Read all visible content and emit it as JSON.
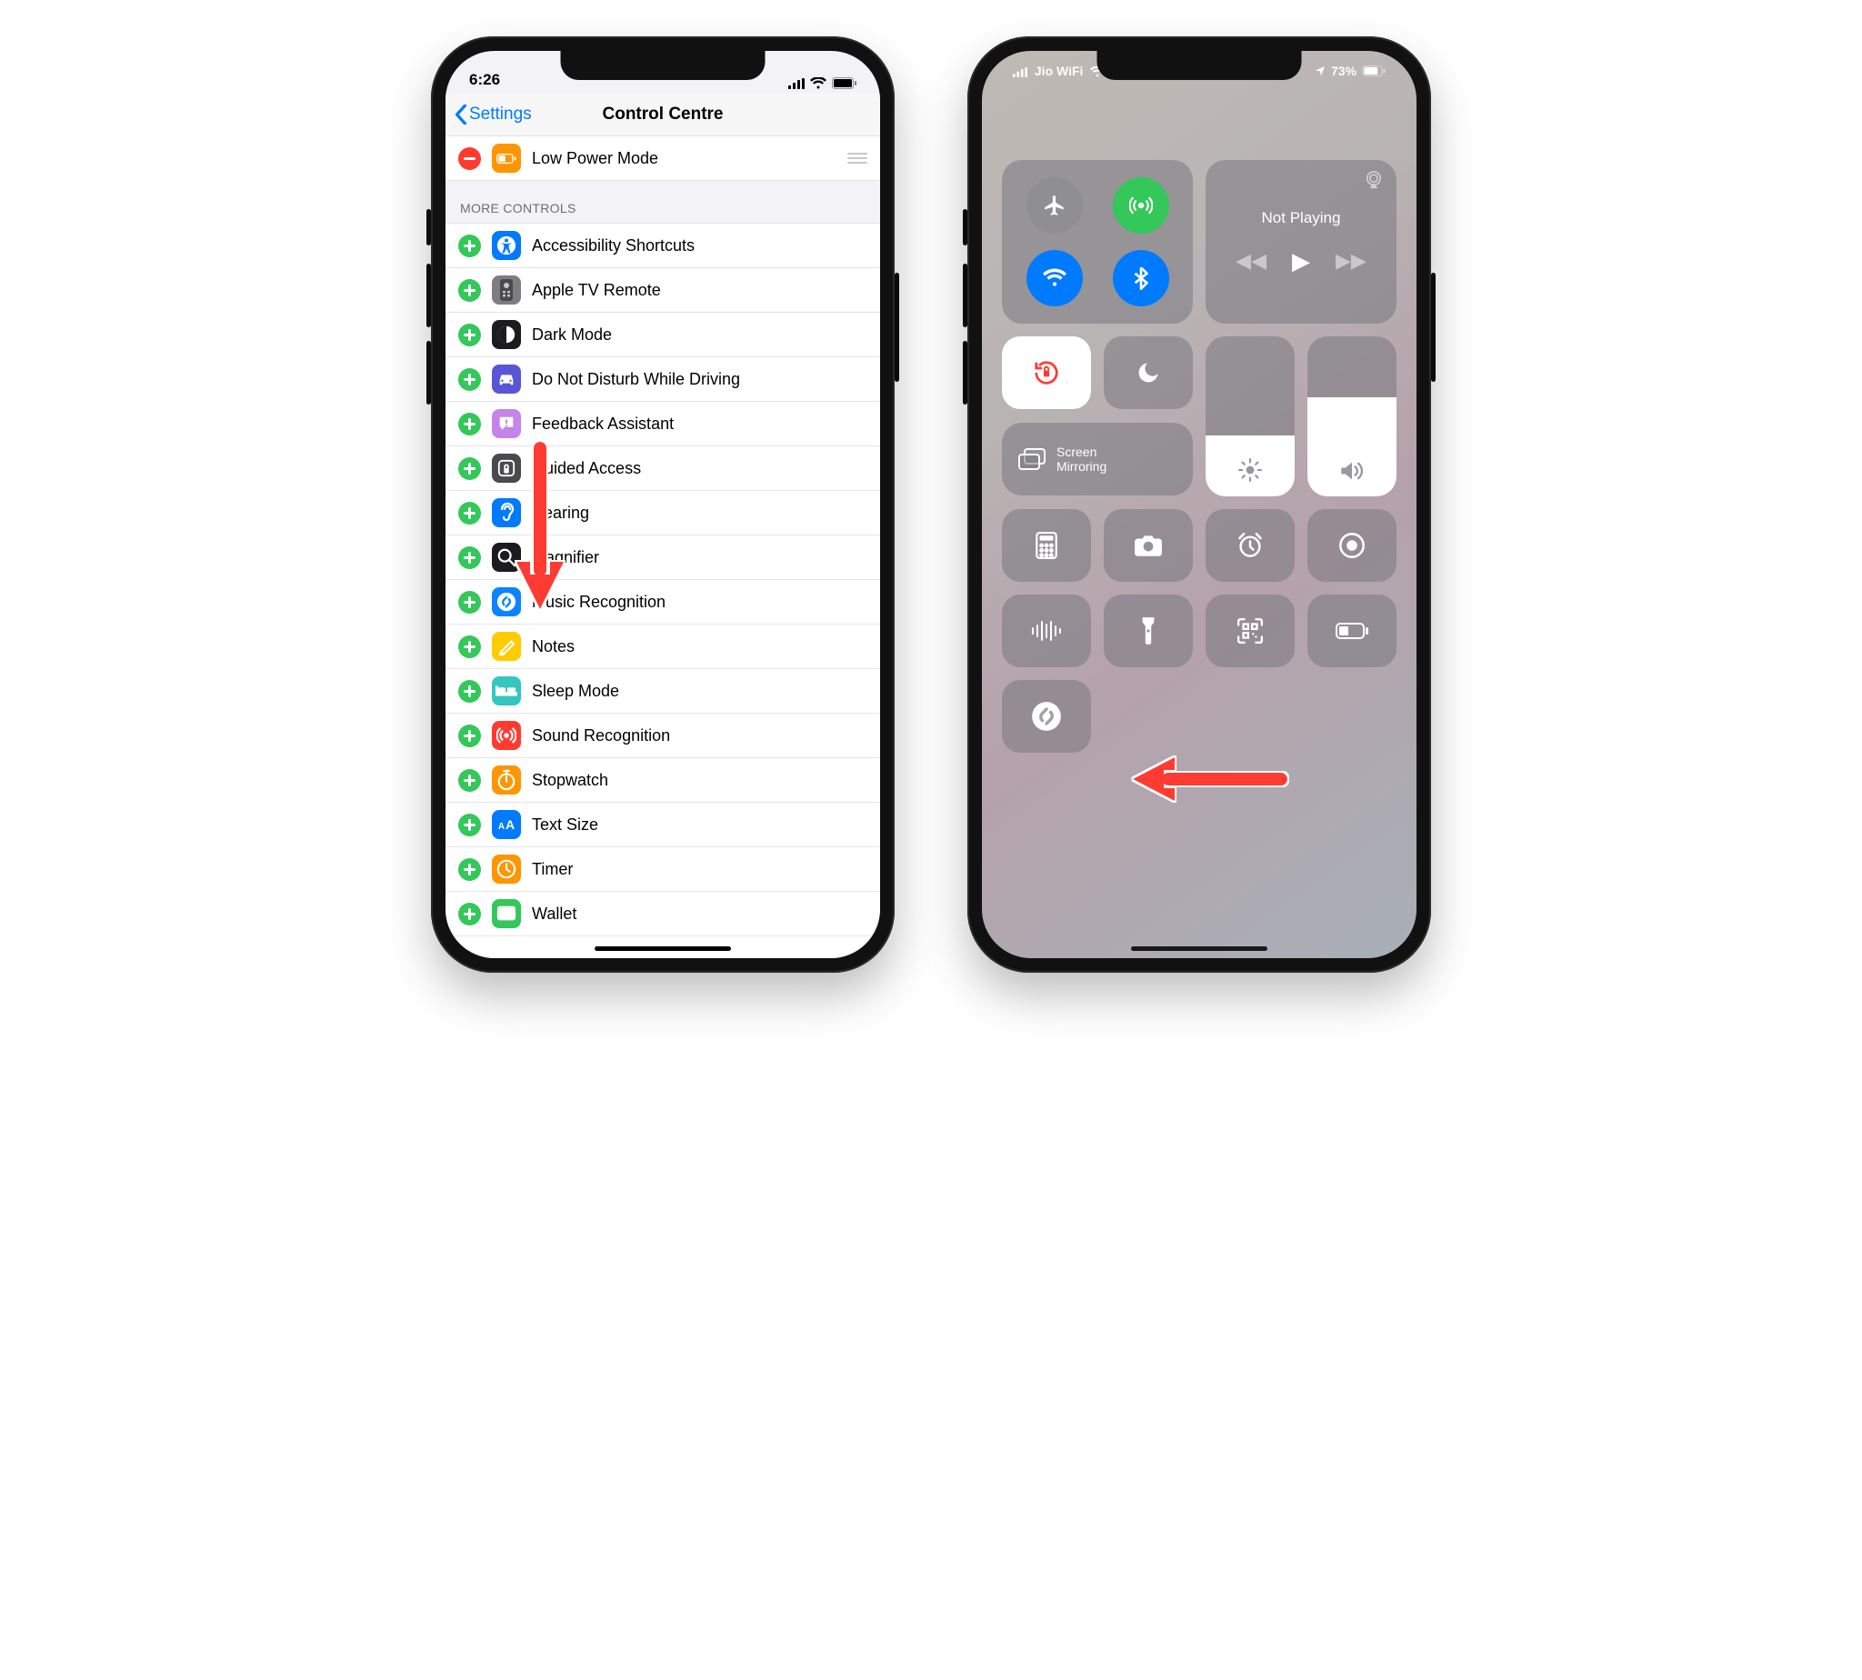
{
  "left": {
    "status": {
      "time": "6:26"
    },
    "nav": {
      "back_label": "Settings",
      "title": "Control Centre"
    },
    "included": [
      {
        "name": "Low Power Mode",
        "icon_bg": "#ff9500",
        "icon": "battery"
      }
    ],
    "more_header": "MORE CONTROLS",
    "more": [
      {
        "name": "Accessibility Shortcuts",
        "icon_bg": "#007aff",
        "icon": "accessibility"
      },
      {
        "name": "Apple TV Remote",
        "icon_bg": "#7d7d82",
        "icon": "remote"
      },
      {
        "name": "Dark Mode",
        "icon_bg": "#1c1c1e",
        "icon": "darkmode"
      },
      {
        "name": "Do Not Disturb While Driving",
        "icon_bg": "#5856d6",
        "icon": "car"
      },
      {
        "name": "Feedback Assistant",
        "icon_bg": "#c584e8",
        "icon": "feedback"
      },
      {
        "name": "Guided Access",
        "icon_bg": "#4a4a4d",
        "icon": "lockapp"
      },
      {
        "name": "Hearing",
        "icon_bg": "#007aff",
        "icon": "ear"
      },
      {
        "name": "Magnifier",
        "icon_bg": "#1c1c1e",
        "icon": "magnify"
      },
      {
        "name": "Music Recognition",
        "icon_bg": "#0a84ff",
        "icon": "shazam"
      },
      {
        "name": "Notes",
        "icon_bg": "#ffcc00",
        "icon": "notes"
      },
      {
        "name": "Sleep Mode",
        "icon_bg": "#34c7bf",
        "icon": "bed"
      },
      {
        "name": "Sound Recognition",
        "icon_bg": "#ff3b30",
        "icon": "sound"
      },
      {
        "name": "Stopwatch",
        "icon_bg": "#ff9500",
        "icon": "stopwatch"
      },
      {
        "name": "Text Size",
        "icon_bg": "#007aff",
        "icon": "textsize"
      },
      {
        "name": "Timer",
        "icon_bg": "#ff9500",
        "icon": "timer"
      },
      {
        "name": "Wallet",
        "icon_bg": "#34c759",
        "icon": "wallet"
      }
    ]
  },
  "right": {
    "status": {
      "carrier": "Jio WiFi",
      "battery": "73%"
    },
    "media": {
      "title": "Not Playing"
    },
    "screen_mirror": "Screen\nMirroring",
    "tiles": [
      "calculator",
      "camera",
      "alarm",
      "screen-record",
      "voice-memo",
      "flashlight",
      "qr-scan",
      "low-power",
      "shazam"
    ]
  }
}
